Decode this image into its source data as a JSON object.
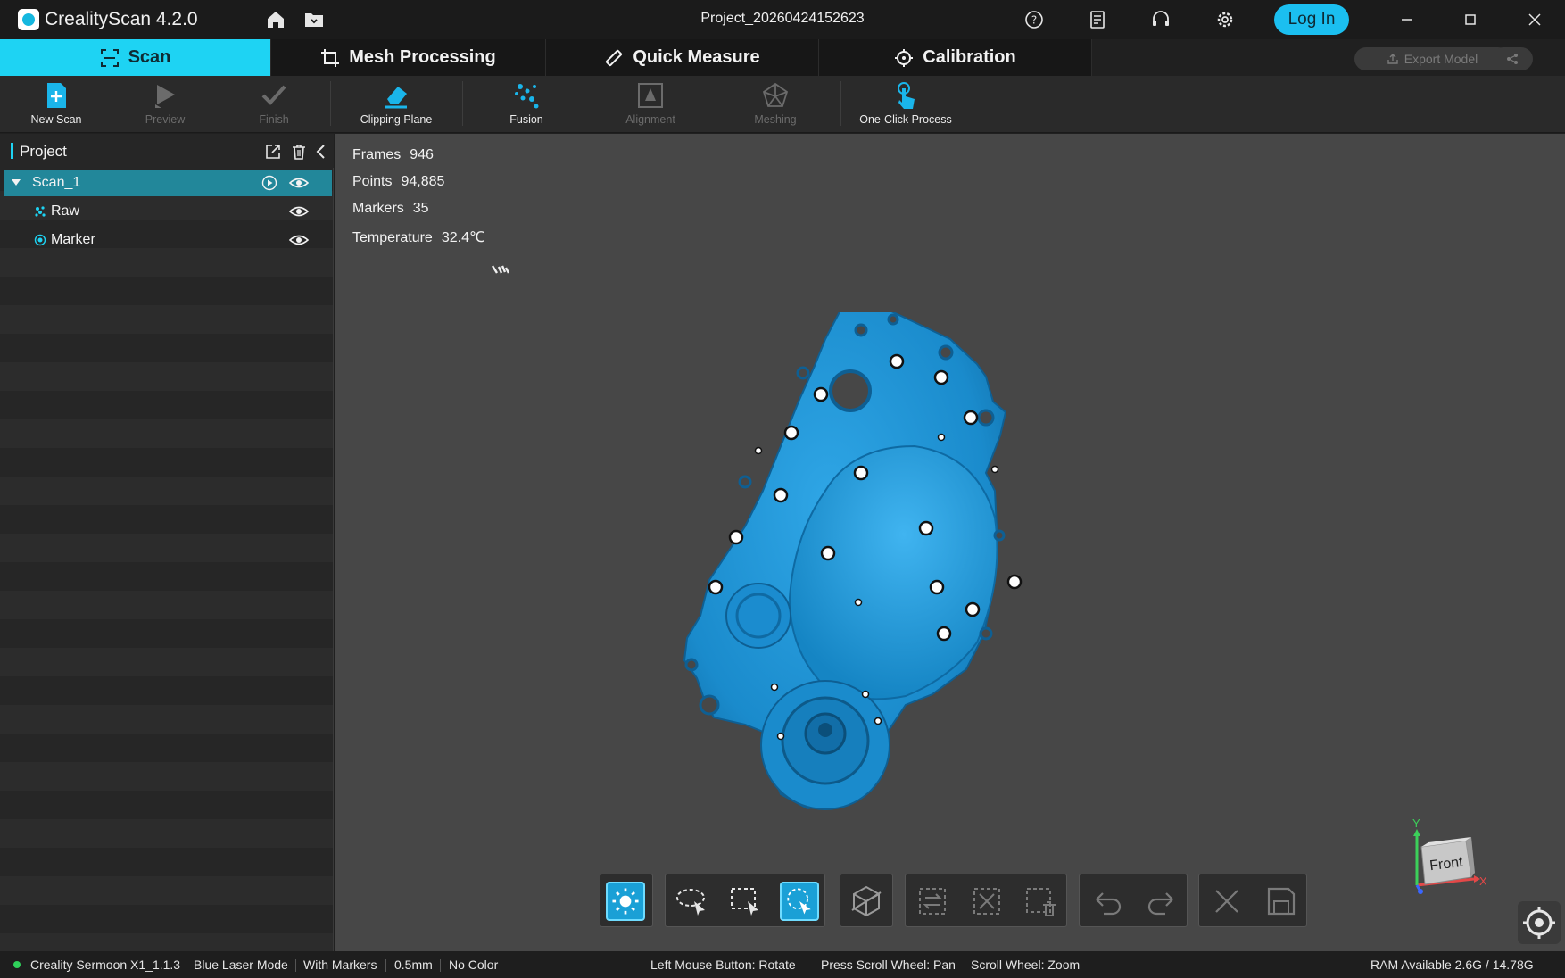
{
  "app": {
    "title": "CrealityScan 4.2.0",
    "project_name": "Project_20260424152623",
    "login_label": "Log In"
  },
  "icons": {
    "home": "home-icon",
    "folder": "folder-icon",
    "help": "help-icon",
    "log": "log-icon",
    "support": "headset-icon",
    "settings": "gear-icon"
  },
  "tabs": [
    {
      "label": "Scan",
      "active": true
    },
    {
      "label": "Mesh Processing",
      "active": false
    },
    {
      "label": "Quick Measure",
      "active": false
    },
    {
      "label": "Calibration",
      "active": false
    }
  ],
  "export_label": "Export Model",
  "toolbar": [
    {
      "label": "New Scan",
      "enabled": true
    },
    {
      "label": "Preview",
      "enabled": false
    },
    {
      "label": "Finish",
      "enabled": false
    },
    {
      "label": "Clipping Plane",
      "enabled": true
    },
    {
      "label": "Fusion",
      "enabled": true
    },
    {
      "label": "Alignment",
      "enabled": false
    },
    {
      "label": "Meshing",
      "enabled": false
    },
    {
      "label": "One-Click Process",
      "enabled": true
    }
  ],
  "project_panel": {
    "title": "Project",
    "tree": [
      {
        "label": "Scan_1",
        "selected": true
      },
      {
        "label": "Raw",
        "selected": false
      },
      {
        "label": "Marker",
        "selected": false
      }
    ]
  },
  "stats": [
    {
      "label": "Frames",
      "value": "946"
    },
    {
      "label": "Points",
      "value": "94,885"
    },
    {
      "label": "Markers",
      "value": "35"
    },
    {
      "label": "Temperature",
      "value": "32.4℃"
    }
  ],
  "view_cube": {
    "face": "Front",
    "x_label": "X",
    "y_label": "Y"
  },
  "status_bar": {
    "device": "Creality Sermoon X1_1.1.3",
    "mode": "Blue Laser Mode",
    "markers": "With Markers",
    "resolution": "0.5mm",
    "color": "No Color",
    "hint_rotate": "Left Mouse Button: Rotate",
    "hint_pan": "Press Scroll Wheel: Pan",
    "hint_zoom": "Scroll Wheel: Zoom",
    "ram": "RAM Available 2.6G / 14.78G"
  },
  "colors": {
    "accent": "#1ed3f3",
    "model": "#1a8fd1",
    "login": "#1bbff0"
  }
}
